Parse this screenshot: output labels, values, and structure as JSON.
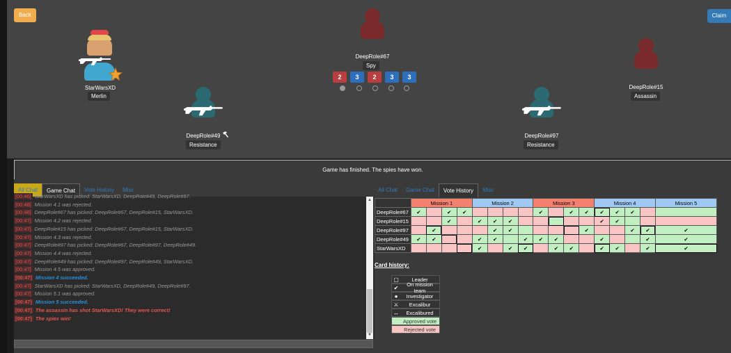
{
  "buttons": {
    "back": "Back",
    "claim": "Claim"
  },
  "players": [
    {
      "name": "StarWarsXD",
      "role": "Merlin"
    },
    {
      "name": "DeepRole#67",
      "role": "Spy"
    },
    {
      "name": "DeepRole#15",
      "role": "Assassin"
    },
    {
      "name": "DeepRole#49",
      "role": "Resistance",
      "hammer": "hammer-icon"
    },
    {
      "name": "DeepRole#97",
      "role": "Resistance"
    }
  ],
  "missions": [
    {
      "team_size": "2",
      "result": "fail"
    },
    {
      "team_size": "3",
      "result": "success"
    },
    {
      "team_size": "2",
      "result": "fail"
    },
    {
      "team_size": "3",
      "result": "success"
    },
    {
      "team_size": "3",
      "result": "success"
    }
  ],
  "colors": {
    "fail": "#b83f3f",
    "success": "#2e6fbd",
    "approve": "#c2efc2",
    "reject": "#f8c4c4",
    "tab_yellow": "#c8a818"
  },
  "status": "Game has finished. The spies have won.",
  "left_tabs": [
    "All Chat",
    "Game Chat",
    "Vote History",
    "Misc"
  ],
  "right_tabs": [
    "All Chat",
    "Game Chat",
    "Vote History",
    "Misc"
  ],
  "chat": [
    {
      "ts": "[00:46]",
      "text": "StarWarsXD has picked: StarWarsXD, DeepRole#49, DeepRole#97.",
      "style": "gray"
    },
    {
      "ts": "[00:46]",
      "text": "Mission 4.1 was rejected.",
      "style": "gray"
    },
    {
      "ts": "[00:46]",
      "text": "DeepRole#67 has picked: DeepRole#67, DeepRole#15, StarWarsXD.",
      "style": "gray"
    },
    {
      "ts": "[00:47]",
      "text": "Mission 4.2 was rejected.",
      "style": "gray"
    },
    {
      "ts": "[00:47]",
      "text": "DeepRole#15 has picked: DeepRole#67, DeepRole#15, StarWarsXD.",
      "style": "gray"
    },
    {
      "ts": "[00:47]",
      "text": "Mission 4.3 was rejected.",
      "style": "gray"
    },
    {
      "ts": "[00:47]",
      "text": "DeepRole#97 has picked: DeepRole#67, DeepRole#97, DeepRole#49.",
      "style": "gray"
    },
    {
      "ts": "[00:47]",
      "text": "Mission 4.4 was rejected.",
      "style": "gray"
    },
    {
      "ts": "[00:47]",
      "text": "DeepRole#49 has picked: DeepRole#97, DeepRole#49, StarWarsXD.",
      "style": "gray"
    },
    {
      "ts": "[00:47]",
      "text": "Mission 4.5 was approved.",
      "style": "gray"
    },
    {
      "ts": "[00:47]",
      "text": "Mission 4 succeeded.",
      "style": "blue"
    },
    {
      "ts": "[00:47]",
      "text": "StarWarsXD has picked: StarWarsXD, DeepRole#49, DeepRole#97.",
      "style": "gray"
    },
    {
      "ts": "[00:47]",
      "text": "Mission 5.1 was approved.",
      "style": "gray"
    },
    {
      "ts": "[00:47]",
      "text": "Mission 5 succeeded.",
      "style": "blue"
    },
    {
      "ts": "[00:47]",
      "text": "The assassin has shot StarWarsXD! They were correct!",
      "style": "red"
    },
    {
      "ts": "[00:47]",
      "text": "The spies win!",
      "style": "red"
    }
  ],
  "vote_history": {
    "missions": [
      "Mission 1",
      "Mission 2",
      "Mission 3",
      "Mission 4",
      "Mission 5"
    ],
    "mission_colors": [
      "#f2826f",
      "#9fc9f3",
      "#f2826f",
      "#9fc9f3",
      "#9fc9f3"
    ],
    "players": [
      "DeepRole#67",
      "DeepRole#15",
      "DeepRole#97",
      "DeepRole#49",
      "StarWarsXD"
    ],
    "rows": [
      [
        "a",
        "r",
        "a",
        "a",
        "r",
        "r",
        "r",
        "r",
        "a",
        "r",
        "a",
        "a",
        "a",
        "a",
        "a",
        "r",
        "a"
      ],
      [
        "r",
        "r",
        "a",
        "r",
        "a",
        "a",
        "a",
        "r",
        "r",
        "a",
        "r",
        "r",
        "r",
        "a",
        "a",
        "r",
        "r"
      ],
      [
        "r",
        "a",
        "r",
        "r",
        "r",
        "a",
        "a",
        "a",
        "r",
        "r",
        "r",
        "a",
        "r",
        "r",
        "a",
        "a",
        "a"
      ],
      [
        "a",
        "a",
        "r",
        "r",
        "a",
        "a",
        "a",
        "a",
        "a",
        "a",
        "r",
        "r",
        "a",
        "r",
        "a",
        "a",
        "a"
      ],
      [
        "r",
        "r",
        "r",
        "r",
        "a",
        "r",
        "a",
        "a",
        "r",
        "a",
        "a",
        "r",
        "a",
        "a",
        "r",
        "a",
        "a"
      ]
    ],
    "team": [
      [
        1,
        0,
        1,
        1,
        0,
        0,
        0,
        0,
        1,
        0,
        1,
        1,
        1,
        1,
        1,
        0,
        0
      ],
      [
        0,
        0,
        1,
        0,
        1,
        1,
        1,
        0,
        0,
        0,
        0,
        0,
        1,
        1,
        0,
        0,
        0
      ],
      [
        0,
        1,
        0,
        0,
        0,
        1,
        1,
        0,
        0,
        0,
        0,
        1,
        0,
        0,
        1,
        1,
        1
      ],
      [
        1,
        1,
        0,
        0,
        1,
        1,
        0,
        1,
        1,
        1,
        0,
        0,
        1,
        0,
        0,
        1,
        1
      ],
      [
        0,
        0,
        0,
        0,
        1,
        0,
        1,
        1,
        0,
        1,
        1,
        0,
        1,
        1,
        0,
        1,
        1
      ]
    ],
    "leader": [
      [
        0,
        0,
        0,
        0,
        0,
        0,
        0,
        0,
        0,
        0,
        0,
        0,
        1,
        0,
        0,
        0,
        0
      ],
      [
        0,
        0,
        0,
        0,
        0,
        0,
        0,
        0,
        0,
        1,
        0,
        0,
        0,
        0,
        0,
        0,
        0
      ],
      [
        0,
        1,
        0,
        0,
        0,
        0,
        0,
        0,
        0,
        0,
        1,
        0,
        0,
        0,
        0,
        1,
        0
      ],
      [
        0,
        0,
        1,
        0,
        0,
        0,
        0,
        0,
        0,
        0,
        0,
        0,
        0,
        0,
        0,
        0,
        0
      ],
      [
        0,
        0,
        0,
        1,
        0,
        0,
        0,
        1,
        0,
        0,
        0,
        0,
        1,
        0,
        0,
        0,
        1
      ]
    ],
    "mission_spans": [
      4,
      4,
      4,
      4,
      1
    ],
    "check": "✔"
  },
  "card_history_label": "Card history:",
  "legend": [
    {
      "icon": "leader-box-icon",
      "label": "Leader",
      "bg": "#333"
    },
    {
      "icon": "check-icon",
      "label": "On mission team",
      "bg": "#333"
    },
    {
      "icon": "investigator-icon",
      "label": "Investigator",
      "bg": "#333"
    },
    {
      "icon": "sword-icon",
      "label": "Excalibur",
      "bg": "#333"
    },
    {
      "icon": "double-arrow-icon",
      "label": "Excalibured",
      "bg": "#333"
    },
    {
      "icon": "",
      "label": "Approved vote",
      "bg": "#c2efc2"
    },
    {
      "icon": "",
      "label": "Rejected vote",
      "bg": "#f8c4c4"
    }
  ]
}
